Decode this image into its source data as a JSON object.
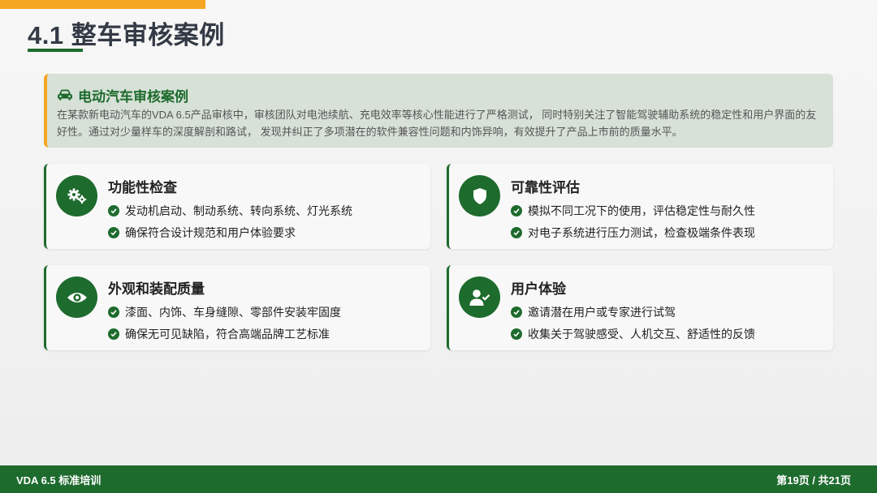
{
  "header": {
    "title": "4.1 整车审核案例"
  },
  "intro": {
    "icon": "car-icon",
    "title": "电动汽车审核案例",
    "text": "在某款新电动汽车的VDA 6.5产品审核中，审核团队对电池续航、充电效率等核心性能进行了严格测试， 同时特别关注了智能驾驶辅助系统的稳定性和用户界面的友好性。通过对少量样车的深度解剖和路试， 发现并纠正了多项潜在的软件兼容性问题和内饰异响，有效提升了产品上市前的质量水平。"
  },
  "cards": [
    {
      "icon": "gears-icon",
      "title": "功能性检查",
      "items": [
        "发动机启动、制动系统、转向系统、灯光系统",
        "确保符合设计规范和用户体验要求"
      ]
    },
    {
      "icon": "shield-icon",
      "title": "可靠性评估",
      "items": [
        "模拟不同工况下的使用，评估稳定性与耐久性",
        "对电子系统进行压力测试，检查极端条件表现"
      ]
    },
    {
      "icon": "eye-icon",
      "title": "外观和装配质量",
      "items": [
        "漆面、内饰、车身缝隙、零部件安装牢固度",
        "确保无可见缺陷，符合高端品牌工艺标准"
      ]
    },
    {
      "icon": "user-check-icon",
      "title": "用户体验",
      "items": [
        "邀请潜在用户或专家进行试驾",
        "收集关于驾驶感受、人机交互、舒适性的反馈"
      ]
    }
  ],
  "footer": {
    "left": "VDA 6.5 标准培训",
    "right": "第19页 / 共21页"
  },
  "colors": {
    "primary": "#1e6b2e",
    "accent": "#f5a623",
    "intro_bg": "#d7e1d7"
  }
}
